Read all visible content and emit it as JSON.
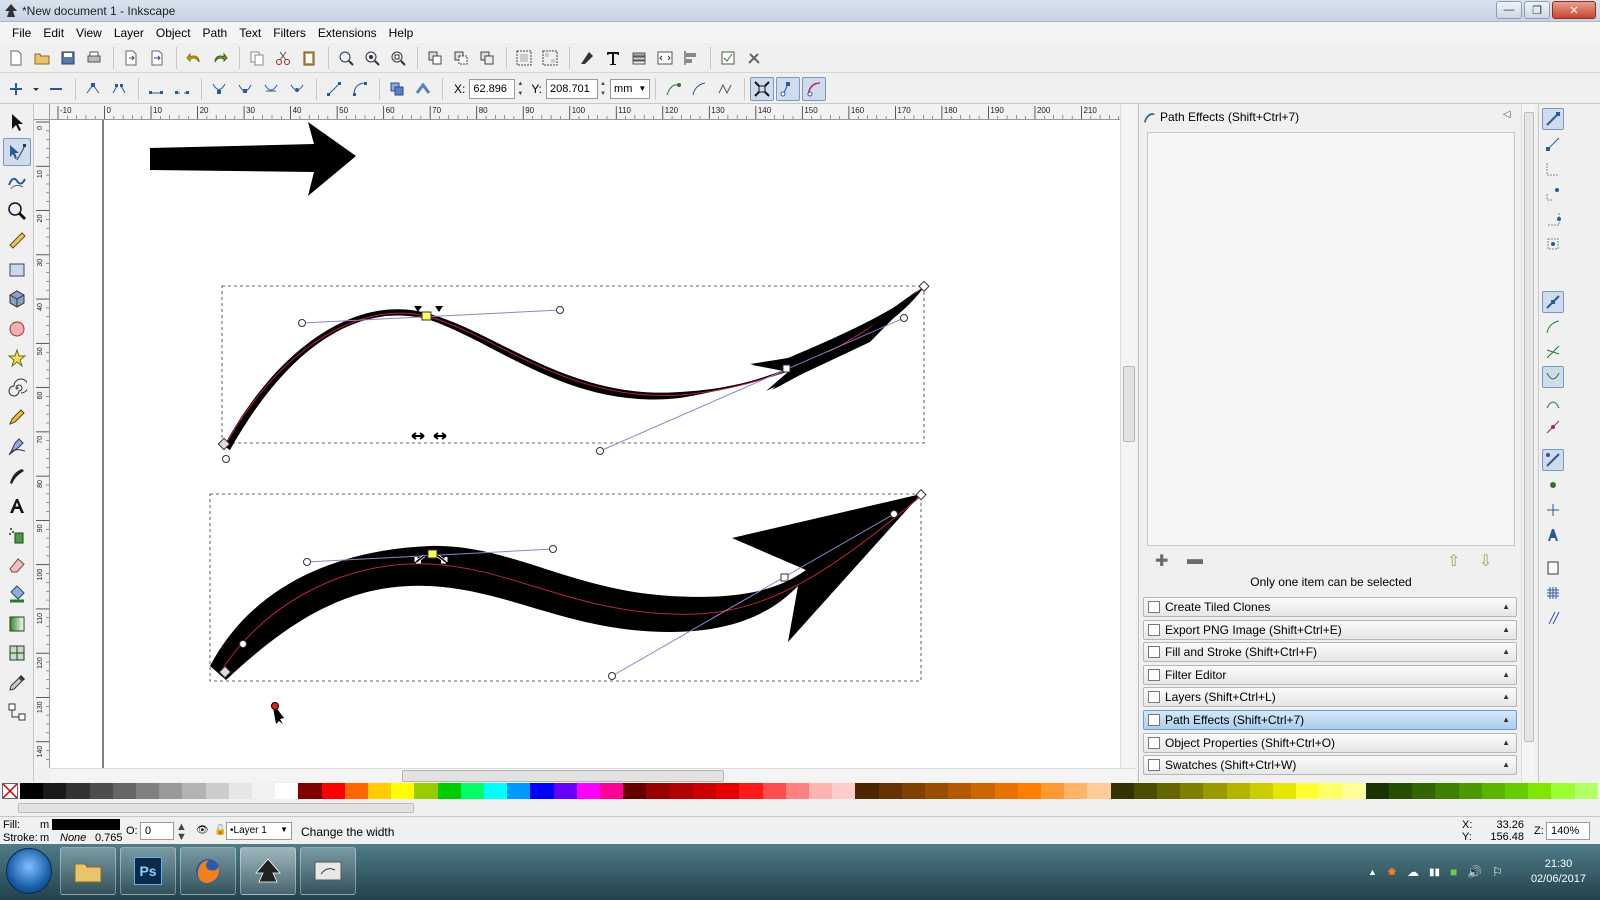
{
  "window": {
    "title": "*New document 1 - Inkscape"
  },
  "menu": [
    "File",
    "Edit",
    "View",
    "Layer",
    "Object",
    "Path",
    "Text",
    "Filters",
    "Extensions",
    "Help"
  ],
  "controls": {
    "x_label": "X:",
    "x_value": "62.896",
    "y_label": "Y:",
    "y_value": "208.701",
    "unit": "mm"
  },
  "hruler": [
    "-10",
    "0",
    "10",
    "20",
    "30",
    "40",
    "50",
    "60",
    "70",
    "80",
    "90",
    "100",
    "110",
    "120",
    "130",
    "140",
    "150",
    "160",
    "170",
    "180",
    "190",
    "200",
    "210"
  ],
  "vruler": [
    "0",
    "10",
    "20",
    "30",
    "40",
    "50",
    "60",
    "70",
    "80",
    "90",
    "100",
    "110",
    "120",
    "130",
    "140"
  ],
  "panel": {
    "title": "Path Effects  (Shift+Ctrl+7)",
    "status": "Only one item can be selected",
    "tabs": [
      {
        "label": "Create Tiled Clones",
        "icon": "tiled-clones-icon",
        "active": false
      },
      {
        "label": "Export PNG Image (Shift+Ctrl+E)",
        "icon": "export-png-icon",
        "active": false
      },
      {
        "label": "Fill and Stroke (Shift+Ctrl+F)",
        "icon": "fill-stroke-icon",
        "active": false
      },
      {
        "label": "Filter Editor",
        "icon": "filter-editor-icon",
        "active": false
      },
      {
        "label": "Layers (Shift+Ctrl+L)",
        "icon": "layers-icon",
        "active": false
      },
      {
        "label": "Path Effects  (Shift+Ctrl+7)",
        "icon": "path-effects-icon",
        "active": true
      },
      {
        "label": "Object Properties (Shift+Ctrl+O)",
        "icon": "object-properties-icon",
        "active": false
      },
      {
        "label": "Swatches (Shift+Ctrl+W)",
        "icon": "swatches-icon",
        "active": false
      }
    ]
  },
  "status": {
    "fill_label": "Fill:",
    "fill_value": "m",
    "stroke_label": "Stroke:",
    "stroke_value": "m",
    "stroke_none": "None",
    "stroke_width": "0.765",
    "opacity_label": "O:",
    "opacity_value": "0",
    "layer": "•Layer 1",
    "message": "Change the width",
    "cursor_x_label": "X:",
    "cursor_x": "33.26",
    "cursor_y_label": "Y:",
    "cursor_y": "156.48",
    "zoom_label": "Z:",
    "zoom": "140%"
  },
  "taskbar": {
    "time": "21:30",
    "date": "02/06/2017",
    "ps_label": "Ps"
  },
  "colors": {
    "palette": [
      "#000000",
      "#1a1a1a",
      "#333333",
      "#4d4d4d",
      "#666666",
      "#808080",
      "#999999",
      "#b3b3b3",
      "#cccccc",
      "#e6e6e6",
      "#f2f2f2",
      "#ffffff",
      "#800000",
      "#ff0000",
      "#ff6600",
      "#ffcc00",
      "#ffff00",
      "#99cc00",
      "#00cc00",
      "#00ff66",
      "#00ffff",
      "#0099ff",
      "#0000ff",
      "#6600ff",
      "#ff00ff",
      "#ff0099",
      "#660000",
      "#990000",
      "#b30000",
      "#cc0000",
      "#e60000",
      "#ff1a1a",
      "#ff4d4d",
      "#ff8080",
      "#ffb3b3",
      "#ffcccc",
      "#4d2600",
      "#663300",
      "#804000",
      "#994d00",
      "#b35900",
      "#cc6600",
      "#e67300",
      "#ff8000",
      "#ff9933",
      "#ffb366",
      "#ffcc99",
      "#333300",
      "#4d4d00",
      "#666600",
      "#808000",
      "#999900",
      "#b3b300",
      "#cccc00",
      "#e6e600",
      "#ffff33",
      "#ffff66",
      "#ffff99",
      "#1a3300",
      "#264d00",
      "#336600",
      "#408000",
      "#4d9900",
      "#59b300",
      "#66cc00",
      "#80e600",
      "#99ff33",
      "#b3ff66"
    ]
  }
}
